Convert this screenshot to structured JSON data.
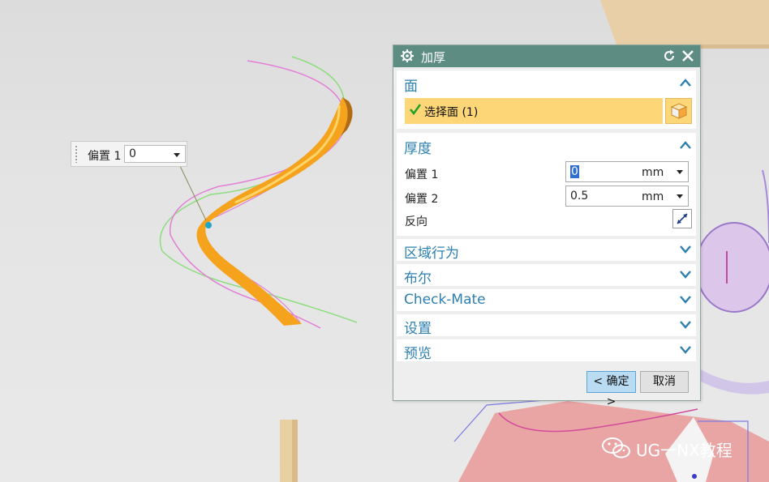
{
  "floating_input": {
    "label": "偏置 1",
    "value": "0"
  },
  "dialog": {
    "title": "加厚",
    "face_group": {
      "title": "面",
      "select_face_label": "选择面 (1)"
    },
    "thickness_group": {
      "title": "厚度",
      "offset1": {
        "label": "偏置 1",
        "value": "0",
        "unit": "mm"
      },
      "offset2": {
        "label": "偏置 2",
        "value": "0.5",
        "unit": "mm"
      },
      "reverse_label": "反向"
    },
    "collapsed_groups": [
      "区域行为",
      "布尔",
      "Check-Mate",
      "设置",
      "预览"
    ],
    "ok_label": "< 确定 >",
    "cancel_label": "取消"
  },
  "watermark": {
    "text": "UG一NX教程"
  },
  "colors": {
    "title_bar": "#5d8c83",
    "group_title": "#2d7fb0",
    "selection_highlight": "#fcd677",
    "ribbon_orange": "#f5a21c",
    "curve_pink": "#e27fd6",
    "curve_green": "#8fdc7f"
  }
}
